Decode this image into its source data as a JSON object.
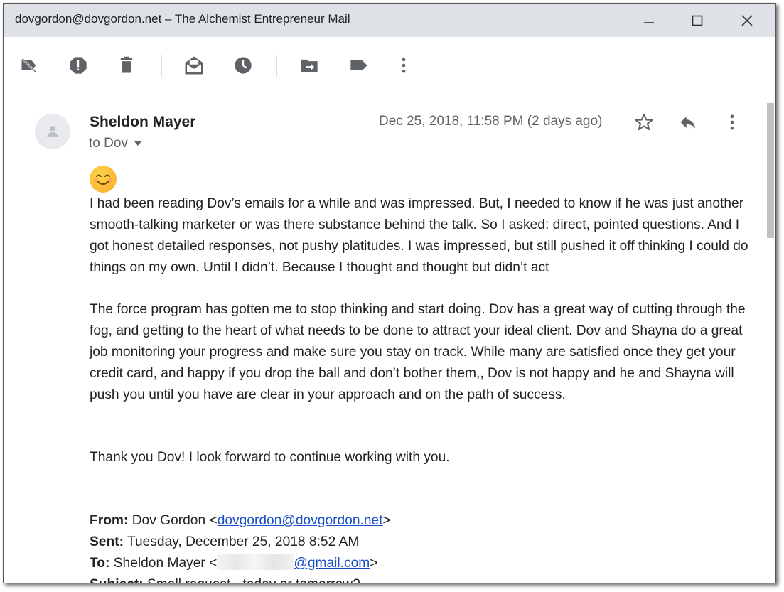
{
  "window": {
    "title": "dovgordon@dovgordon.net – The Alchemist Entrepreneur Mail"
  },
  "toolbar": {
    "icons": [
      "label-off-icon",
      "report-spam-icon",
      "delete-icon",
      "mark-unread-icon",
      "snooze-icon",
      "move-to-icon",
      "label-icon",
      "more-vert-icon"
    ]
  },
  "message": {
    "sender": "Sheldon Mayer",
    "to_label": "to Dov",
    "date": "Dec 25, 2018, 11:58 PM (2 days ago)",
    "paragraph1": "I had been reading Dov’s emails for a while and was impressed. But, I needed to know if he was just another smooth-talking marketer or was there substance behind the talk. So I asked: direct, pointed questions. And I got honest detailed responses, not pushy platitudes. I was impressed, but still pushed it off thinking I could do things on my own. Until I didn’t. Because I thought and thought but didn’t act",
    "paragraph2": "The force program has gotten me to stop thinking and start doing. Dov has a great way of cutting through the fog, and getting to the heart of what needs to be done to attract your ideal client. Dov and Shayna do a great job monitoring your progress and make sure you stay on track. While many are satisfied once they get your credit card, and happy if you drop the ball and don’t bother them,, Dov is not happy  and he and Shayna will push you until you have are clear in your approach and on the path of success.",
    "paragraph3": "Thank you Dov! I look forward to continue working with you."
  },
  "quoted": {
    "from_label": "From:",
    "from_name": " Dov Gordon <",
    "from_email": "dovgordon@dovgordon.net",
    "from_close": ">",
    "sent_label": "Sent:",
    "sent_value": " Tuesday, December 25, 2018 8:52 AM",
    "to_label": "To:",
    "to_name": " Sheldon Mayer <",
    "to_email": "@gmail.com",
    "to_close": ">",
    "subject_label": "Subject:",
    "subject_value": " Small request - today or tomorrow?"
  }
}
